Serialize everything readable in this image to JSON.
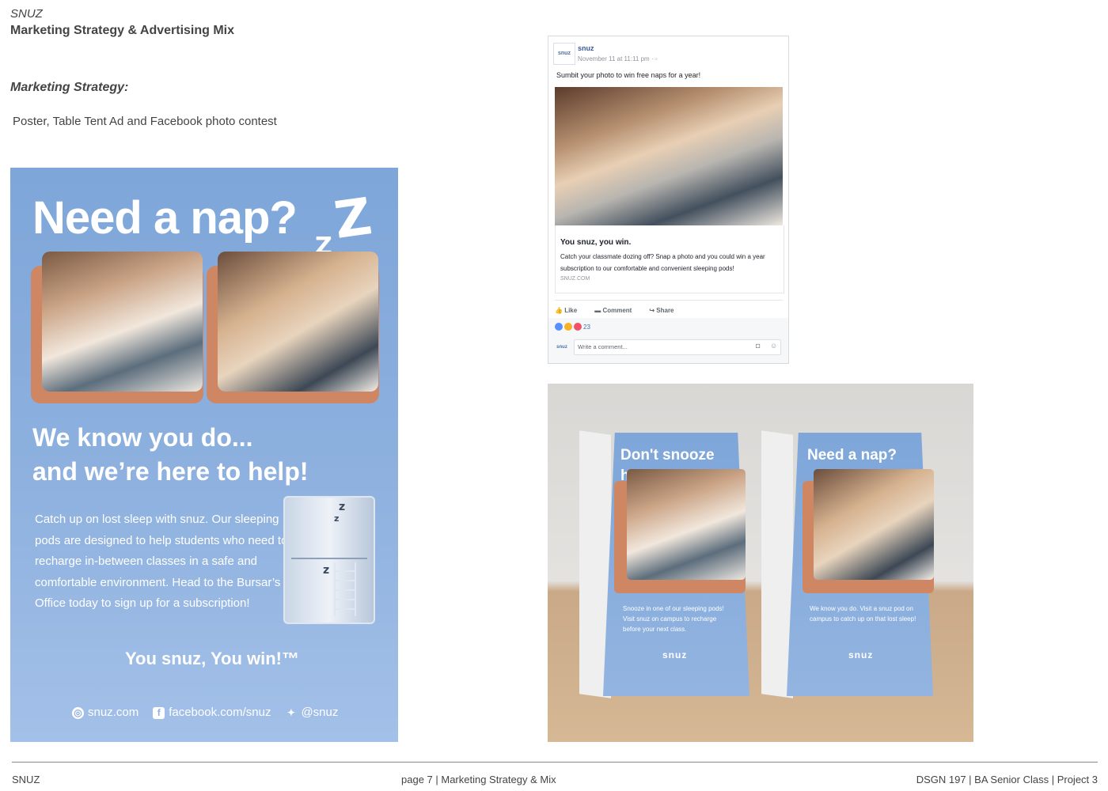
{
  "header": {
    "brand": "SNUZ",
    "title": "Marketing Strategy & Advertising Mix"
  },
  "strategy": {
    "heading": "Marketing Strategy:",
    "text": "Poster, Table Tent Ad and Facebook photo contest"
  },
  "poster": {
    "headline": "Need a nap?",
    "tagline_line1": "We know you do...",
    "tagline_line2": "and we’re here to help!",
    "body": "Catch up on lost sleep with snuz. Our sleeping pods are designed to help students who need to recharge in-between classes in a safe and comfortable environment. Head to the Bursar’s Office today to sign up for a subscription!",
    "slogan": "You snuz, You win!™",
    "links": {
      "website": "snuz.com",
      "facebook": "facebook.com/snuz",
      "twitter": "@snuz"
    }
  },
  "facebook_post": {
    "avatar_text": "snuz",
    "page_name": "snuz",
    "date": "November 11 at 11:11 pm · ",
    "post_text": "Sumbit your photo to win free naps for a year!",
    "card_title": "You snuz, you win.",
    "card_description": "Catch your classmate dozing off? Snap a photo and you could win a year subscription to our comfortable and convenient sleeping pods!",
    "card_domain": "SNUZ.COM",
    "actions": [
      "Like",
      "Comment",
      "Share"
    ],
    "reaction_count": "23",
    "comment_placeholder": "Write a comment..."
  },
  "table_tent": {
    "left_headline": "Don't snooze here...",
    "left_body": "Snooze in one of our sleeping pods! Visit snuz on campus to recharge before your next class.",
    "right_headline": "Need a nap?",
    "right_body": "We know you do. Visit a snuz pod on campus to catch up on that lost sleep!",
    "logo": "snuz"
  },
  "footer": {
    "left": "SNUZ",
    "center": "page 7  | Marketing Strategy & Mix",
    "right": "DSGN 197 | BA Senior Class | Project 3"
  }
}
